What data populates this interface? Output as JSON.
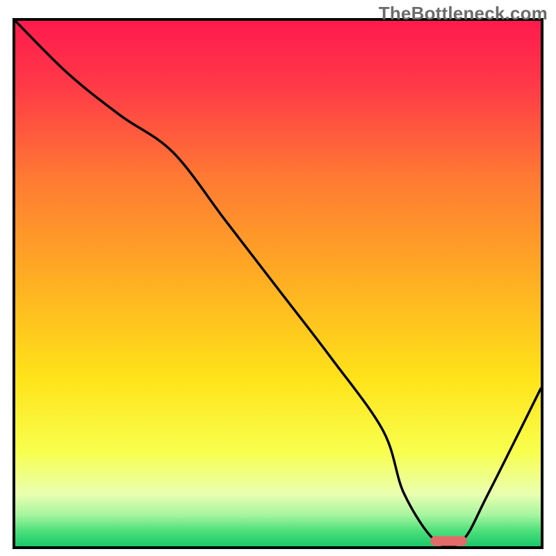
{
  "watermark": "TheBottleneck.com",
  "chart_data": {
    "type": "line",
    "title": "",
    "xlabel": "",
    "ylabel": "",
    "xlim": [
      0,
      100
    ],
    "ylim": [
      0,
      100
    ],
    "grid": false,
    "legend": false,
    "series": [
      {
        "name": "bottleneck-curve",
        "x": [
          0,
          10,
          20,
          30,
          40,
          50,
          60,
          70,
          74,
          80,
          85,
          90,
          100
        ],
        "y": [
          100,
          90,
          82,
          75,
          62,
          49,
          36,
          22,
          10,
          1,
          1,
          10,
          30
        ]
      }
    ],
    "marker": {
      "name": "optimal-range-marker",
      "x_start": 79,
      "x_end": 86,
      "y": 1,
      "color": "#e46a6a"
    },
    "gradient_stops": [
      {
        "offset": 0.0,
        "color": "#ff1a4d"
      },
      {
        "offset": 0.12,
        "color": "#ff3848"
      },
      {
        "offset": 0.3,
        "color": "#ff7a33"
      },
      {
        "offset": 0.5,
        "color": "#ffb022"
      },
      {
        "offset": 0.68,
        "color": "#ffe31a"
      },
      {
        "offset": 0.82,
        "color": "#f8ff4d"
      },
      {
        "offset": 0.9,
        "color": "#eaffb0"
      },
      {
        "offset": 0.94,
        "color": "#a8f5a0"
      },
      {
        "offset": 0.97,
        "color": "#4fe07c"
      },
      {
        "offset": 1.0,
        "color": "#19c96a"
      }
    ]
  }
}
